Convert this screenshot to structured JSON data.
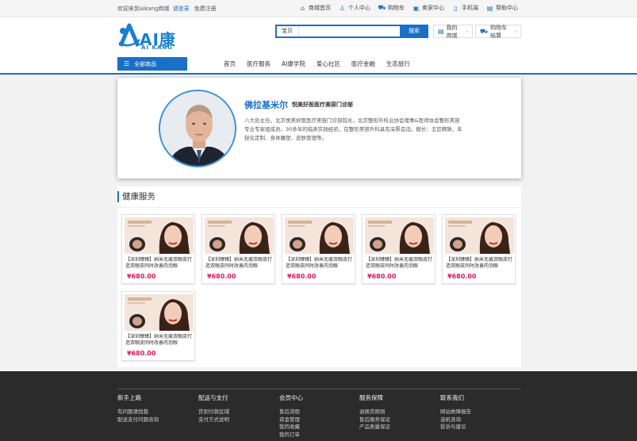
{
  "topbar": {
    "welcome": "欢迎来到aikang商城",
    "login": "请登录",
    "register": "免费注册",
    "links": [
      {
        "label": "商城首页",
        "icon": "home-icon"
      },
      {
        "label": "个人中心",
        "icon": "user-icon"
      },
      {
        "label": "购物车",
        "icon": "cart-icon"
      },
      {
        "label": "卖家中心",
        "icon": "store-icon"
      },
      {
        "label": "手机端",
        "icon": "mobile-icon"
      },
      {
        "label": "帮助中心",
        "icon": "help-icon"
      }
    ]
  },
  "header": {
    "logo_cn": "AI康",
    "logo_en": "AI KANG",
    "search_label": "宝贝",
    "search_value": "",
    "search_button": "搜索",
    "my_mall": "我的商城",
    "cart_checkout": "购物车结算"
  },
  "nav": {
    "all_categories": "全部商品",
    "items": [
      "首页",
      "医疗服务",
      "AI康学院",
      "爱心社区",
      "医疗金融",
      "生态旅行"
    ]
  },
  "profile": {
    "name": "佛拉基米尔",
    "title": "悦美好医医疗美容门诊部",
    "bio": "八大处主任，北京悦美好医医疗美容门诊部院长，北京整形外科业协会理事&医师协会整形美容专业专家组成员。30多年的临床实践经验，在整形美容外科具有深厚造诣。擅长：五官精致、年轻化定制、身体雕塑、皮肤管理等。"
  },
  "health": {
    "section_title": "健康服务",
    "products": [
      {
        "desc": "【深圳臻臻】纳米无痕双眼皮打造双眼皮同时改善肉泡眼",
        "price": "¥680.00"
      },
      {
        "desc": "【深圳臻臻】纳米无痕双眼皮打造双眼皮同时改善肉泡眼",
        "price": "¥680.00"
      },
      {
        "desc": "【深圳臻臻】纳米无痕双眼皮打造双眼皮同时改善肉泡眼",
        "price": "¥680.00"
      },
      {
        "desc": "【深圳臻臻】纳米无痕双眼皮打造双眼皮同时改善肉泡眼",
        "price": "¥680.00"
      },
      {
        "desc": "【深圳臻臻】纳米无痕双眼皮打造双眼皮同时改善肉泡眼",
        "price": "¥680.00"
      },
      {
        "desc": "【深圳臻臻】纳米无痕双眼皮打造双眼皮同时改善肉泡眼",
        "price": "¥680.00"
      }
    ]
  },
  "footer": {
    "columns": [
      {
        "title": "新手上路",
        "items": [
          "有问题请找我",
          "配送支付问题咨询"
        ]
      },
      {
        "title": "配送与支付",
        "items": [
          "货到付款区域",
          "支付方式说明"
        ]
      },
      {
        "title": "会员中心",
        "items": [
          "售后流程",
          "资金管理",
          "我的收藏",
          "我的订单"
        ]
      },
      {
        "title": "服务保障",
        "items": [
          "退换货原则",
          "售后服务保证",
          "产品质量保证"
        ]
      },
      {
        "title": "联系我们",
        "items": [
          "网站故障报告",
          "选机咨询",
          "投诉与建议"
        ]
      }
    ]
  },
  "colors": {
    "brand": "#1a6fc6",
    "price": "#e0185a",
    "footer_bg": "#2b2b2b"
  }
}
